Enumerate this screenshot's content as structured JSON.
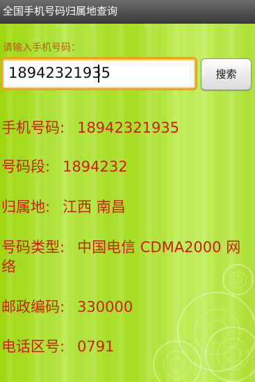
{
  "window": {
    "title": "全国手机号码归属地查询"
  },
  "search": {
    "prompt": "请输入手机号码：",
    "input_value": "18942321935",
    "button_label": "搜索"
  },
  "results": [
    {
      "label": "手机号码:",
      "value": "18942321935"
    },
    {
      "label": "号码段:",
      "value": "1894232"
    },
    {
      "label": "归属地:",
      "value": "江西 南昌"
    },
    {
      "label": "号码类型:",
      "value": "中国电信 CDMA2000 网"
    },
    {
      "label": "",
      "value": "络"
    },
    {
      "label": "邮政编码:",
      "value": "330000"
    },
    {
      "label": "电话区号:",
      "value": "0791"
    }
  ],
  "colors": {
    "accent": "#cc1d00",
    "prompt": "#b85a10",
    "background": "#b7e84a",
    "titlebar": "#3b3b3b",
    "input_border": "#f0a21a"
  }
}
